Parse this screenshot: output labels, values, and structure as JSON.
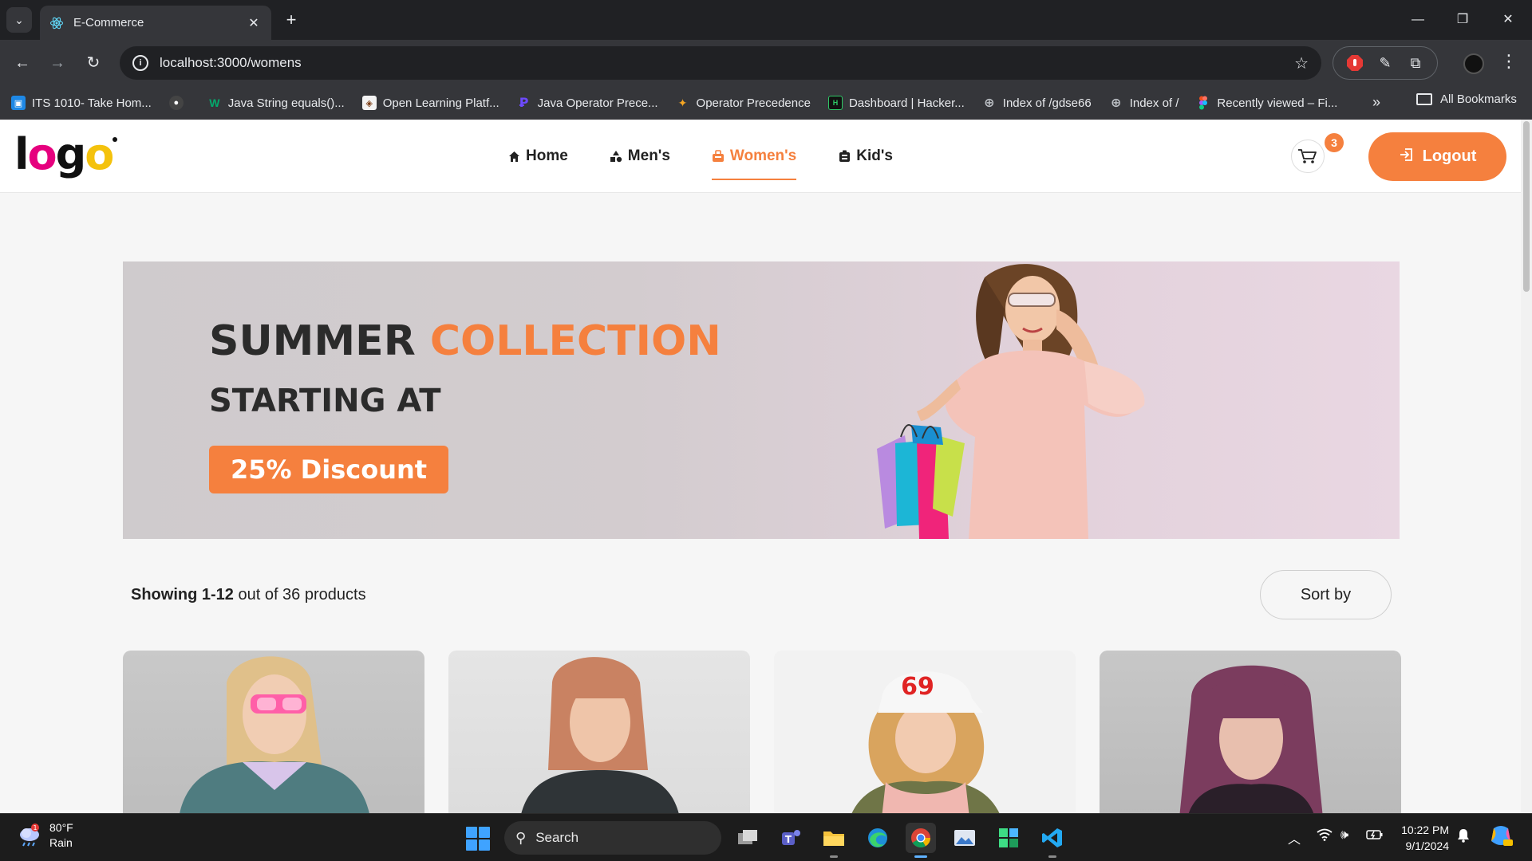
{
  "browser": {
    "tab_title": "E-Commerce",
    "url": "localhost:3000/womens",
    "bookmarks": [
      {
        "label": "ITS 1010- Take Hom...",
        "icon": "google-classroom-icon",
        "color": "#1e88e5"
      },
      {
        "label": "",
        "icon": "github-icon",
        "color": "#555555"
      },
      {
        "label": "Java String equals()...",
        "icon": "w3-icon",
        "color": "#04aa6d"
      },
      {
        "label": "Open Learning Platf...",
        "icon": "university-icon",
        "color": "#f4f4f4"
      },
      {
        "label": "Java Operator Prece...",
        "icon": "programiz-icon",
        "color": "#6d4aff"
      },
      {
        "label": "Operator Precedence",
        "icon": "operator-icon",
        "color": "#f5a623"
      },
      {
        "label": "Dashboard | Hacker...",
        "icon": "hackerrank-icon",
        "color": "#111111"
      },
      {
        "label": "Index of /gdse66",
        "icon": "globe-icon",
        "color": "#9aa0a6"
      },
      {
        "label": "Index of /",
        "icon": "globe-icon",
        "color": "#9aa0a6"
      },
      {
        "label": "Recently viewed – Fi...",
        "icon": "figma-icon",
        "color": "#f24e1e"
      }
    ],
    "all_bookmarks_label": "All Bookmarks"
  },
  "site": {
    "logo_text": {
      "l": "l",
      "o1": "o",
      "g": "g",
      "o2": "o"
    },
    "nav": [
      {
        "label": "Home",
        "icon": "home-icon",
        "active": false
      },
      {
        "label": "Men's",
        "icon": "shapes-icon",
        "active": false
      },
      {
        "label": "Women's",
        "icon": "shop-icon",
        "active": true
      },
      {
        "label": "Kid's",
        "icon": "bag-icon",
        "active": false
      }
    ],
    "cart_count": "3",
    "logout_label": "Logout",
    "accent_color": "#f5803e"
  },
  "banner": {
    "title_part1": "SUMMER",
    "title_part2": "COLLECTION",
    "subtitle": "STARTING AT",
    "discount_label": "25% Discount"
  },
  "listing": {
    "showing_bold": "Showing 1-12",
    "showing_rest": " out of 36 products",
    "sort_label": "Sort by"
  },
  "products": [
    {
      "name": "woman-pink-sunglasses-photo"
    },
    {
      "name": "woman-copper-hair-photo"
    },
    {
      "name": "woman-white-cap-photo"
    },
    {
      "name": "woman-purple-bangs-photo"
    }
  ],
  "taskbar": {
    "weather_temp": "80°F",
    "weather_desc": "Rain",
    "weather_badge": "1",
    "search_label": "Search",
    "time": "10:22 PM",
    "date": "9/1/2024"
  }
}
